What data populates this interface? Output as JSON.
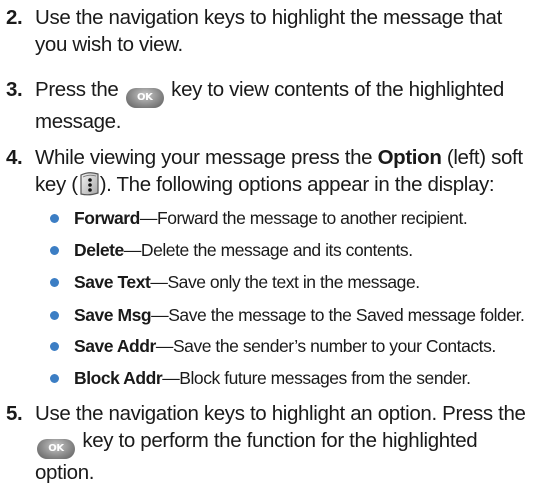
{
  "steps": [
    {
      "number": "2.",
      "text": "Use the navigation keys to highlight the message that you wish to view."
    },
    {
      "number": "3.",
      "text_before": "Press the",
      "text_after": "key to view contents of the highlighted message.",
      "key_label": "OK"
    },
    {
      "number": "4.",
      "text_part1": "While viewing your message press the",
      "bold": "Option",
      "text_part2": "(left) soft key (",
      "text_part3": "). The following options appear in the display:"
    },
    {
      "number": "5.",
      "text_part1": "Use the navigation keys to highlight an option. Press the",
      "key_label": "OK",
      "text_part2": "key to perform the function for the highlighted option."
    }
  ],
  "options": [
    {
      "term": "Forward",
      "description": "Forward the message to another recipient."
    },
    {
      "term": "Delete",
      "description": "Delete the message and its contents."
    },
    {
      "term": "Save Text",
      "description": "Save only the text in the message."
    },
    {
      "term": "Save Msg",
      "description": "Save the message to the Saved message folder."
    },
    {
      "term": "Save Addr",
      "description": "Save the sender’s number to your Contacts."
    },
    {
      "term": "Block Addr",
      "description": "Block future messages from the sender."
    }
  ],
  "separator": "—",
  "colors": {
    "text": "#1a1a1a",
    "bullet": "#3c7ec4"
  },
  "icons": {
    "ok_key": "ok-key-icon",
    "left_soft_key": "left-soft-key-icon"
  }
}
